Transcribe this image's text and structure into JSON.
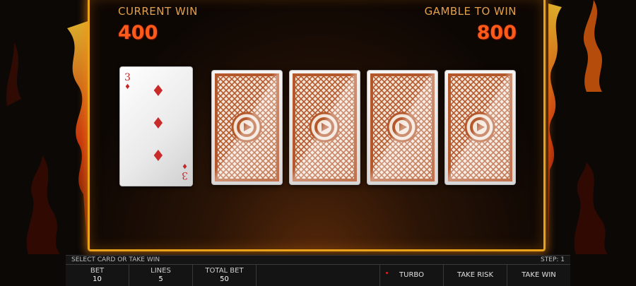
{
  "header": {
    "current_win_label": "CURRENT WIN",
    "current_win_value": "400",
    "gamble_to_win_label": "GAMBLE TO WIN",
    "gamble_to_win_value": "800"
  },
  "dealer_card": {
    "rank": "3",
    "suit": "♦",
    "suit_name": "diamonds",
    "color": "#c92a2a"
  },
  "card_backs": [
    "card-back",
    "card-back",
    "card-back",
    "card-back"
  ],
  "message": {
    "left": "SELECT CARD OR TAKE WIN",
    "right": "STEP: 1"
  },
  "stats": {
    "bet_label": "BET",
    "bet_value": "10",
    "lines_label": "LINES",
    "lines_value": "5",
    "total_bet_label": "TOTAL BET",
    "total_bet_value": "50"
  },
  "buttons": {
    "turbo": "TURBO",
    "take_risk": "TAKE RISK",
    "take_win": "TAKE WIN"
  },
  "colors": {
    "frame": "#e8a21a",
    "label": "#e3a04a",
    "amount": "#ff5a1a",
    "card_back": "#b4582c"
  }
}
